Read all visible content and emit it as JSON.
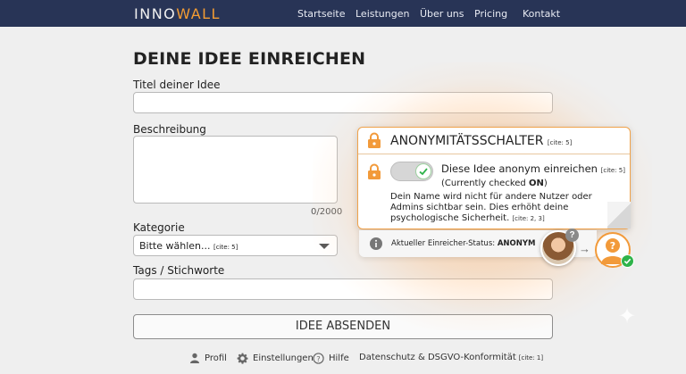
{
  "nav": {
    "logo_a": "INNO",
    "logo_b": "WALL",
    "links": [
      "Startseite",
      "Leistungen",
      "Über uns",
      "Pricing",
      "Kontakt"
    ]
  },
  "form": {
    "title": "DEINE IDEE EINREICHEN",
    "title_label": "Titel deiner Idee",
    "title_value": "",
    "desc_label": "Beschreibung",
    "desc_counter": "0/2000",
    "category_label": "Kategorie",
    "category_selected": "Bitte wählen...",
    "category_cite": "[cite: 5]",
    "tags_label": "Tags / Stichworte",
    "submit_label": "IDEE ABSENDEN"
  },
  "anon_panel": {
    "title": "ANONYMITÄTSSCHALTER",
    "title_cite": "[cite: 5]",
    "toggle_label": "Diese Idee anonym einreichen",
    "toggle_cite": "[cite: 5]",
    "toggle_state_prefix": "(Currently checked ",
    "toggle_state": "ON",
    "toggle_state_suffix": ")",
    "toggle_checked": true,
    "description": "Dein Name wird nicht für andere Nutzer oder Admins sichtbar sein. Dies erhöht deine psychologische Sicherheit.",
    "description_cite": "[cite: 2, 3]",
    "status_label": "Aktueller Einreicher-Status: ",
    "status_value": "ANONYM"
  },
  "footer": {
    "profile": "Profil",
    "settings": "Einstellungen",
    "help": "Hilfe",
    "privacy": "Datenschutz & DSGVO-Konformität",
    "privacy_cite": "[cite: 1]"
  },
  "colors": {
    "navbar": "#283456",
    "accent": "#f39c33",
    "success": "#2fb34a"
  }
}
